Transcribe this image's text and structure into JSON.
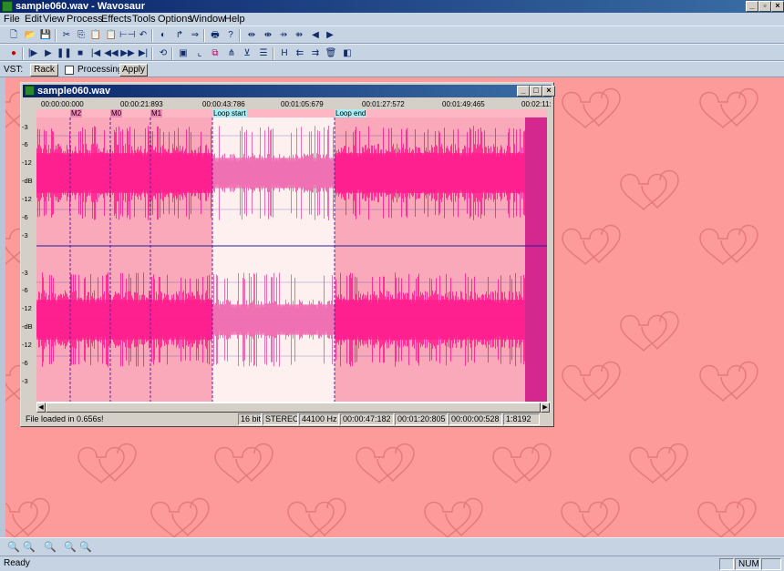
{
  "app": {
    "title": "sample060.wav - Wavosaur"
  },
  "menu": [
    "File",
    "Edit",
    "View",
    "Process",
    "Effects",
    "Tools",
    "Options",
    "Window",
    "Help"
  ],
  "toolbar1_icons": [
    "new-icon",
    "open-icon",
    "save-icon",
    "cut-icon",
    "copy-icon",
    "paste-icon",
    "paste-special-icon",
    "trim-icon",
    "undo-icon",
    "normalize-icon",
    "redo-icon",
    "loop-icon",
    "print-icon",
    "help-icon",
    "expand-icon",
    "marker-icon",
    "marker-move-icon",
    "marker-split-icon",
    "nudge-left-icon",
    "nudge-right-icon"
  ],
  "toolbar2_icons": [
    "record-icon",
    "play-from-start-icon",
    "play-icon",
    "pause-icon",
    "stop-icon",
    "go-start-icon",
    "rewind-icon",
    "fast-forward-icon",
    "go-end-icon",
    "loop-play-icon",
    "select-left-icon",
    "select-right-icon",
    "crop-icon",
    "split-icon",
    "align-icon",
    "view-icon",
    "marker-set-icon",
    "marker-prev-icon",
    "marker-next-icon",
    "delete-icon",
    "record-settings-icon"
  ],
  "vst": {
    "label": "VST:",
    "rack": "Rack",
    "processing": "Processing",
    "apply": "Apply"
  },
  "child": {
    "title": "sample060.wav",
    "ruler": [
      "00:00:00:000",
      "00:00:21:893",
      "00:00:43:786",
      "00:01:05:679",
      "00:01:27:572",
      "00:01:49:465",
      "00:02:11:"
    ],
    "markers": [
      {
        "label": "M2",
        "type": "marker"
      },
      {
        "label": "M0",
        "type": "marker"
      },
      {
        "label": "M1",
        "type": "marker"
      },
      {
        "label": "Loop start",
        "type": "loop"
      },
      {
        "label": "Loop end",
        "type": "loop"
      }
    ],
    "db_labels": [
      "-3",
      "-6",
      "-12",
      "-dB",
      "-12",
      "-6",
      "-3"
    ],
    "status": {
      "message": "File loaded in 0.656s!",
      "bits": "16 bit",
      "channels": "STEREO",
      "rate": "44100 Hz",
      "pos1": "00:00:47:182",
      "pos2": "00:01:20:805",
      "pos3": "00:00:00:528",
      "zoom": "1:8192"
    }
  },
  "zoom_icons": [
    "zoom-in-icon",
    "zoom-out-icon",
    "zoom-fit-icon",
    "zoom-selection-icon",
    "zoom-full-icon"
  ],
  "statusbar": {
    "text": "Ready",
    "num": "NUM"
  },
  "colors": {
    "background": "#fd9b9b",
    "waveform": "#ff1b8d",
    "selection": "#fff2f2",
    "chrome": "#c6d3e2"
  }
}
